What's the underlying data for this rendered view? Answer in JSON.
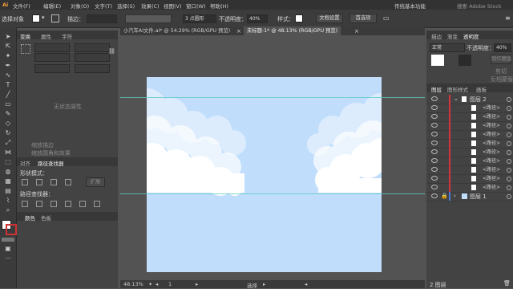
{
  "menu": {
    "logo": "Ai",
    "items": [
      "文件(F)",
      "编辑(E)",
      "对象(O)",
      "文字(T)",
      "选择(S)",
      "效果(C)",
      "视图(V)",
      "窗口(W)",
      "帮助(H)"
    ],
    "workspace": "传统基本功能",
    "search_placeholder": "搜索 Adobe Stock"
  },
  "control": {
    "selection_label": "选择对象",
    "stroke_label": "描边：",
    "brush_value": "3 点圆形",
    "opacity_label": "不透明度：",
    "opacity_value": "40%",
    "style_label": "样式：",
    "doc_setup": "文档设置",
    "preferences": "首选项"
  },
  "doc_tabs": [
    {
      "label": "小汽车AI文件.ai* @ 54.29% (RGB/GPU 预览)",
      "active": false
    },
    {
      "label": "未标题-1* @ 48.13% (RGB/GPU 预览)",
      "active": true
    }
  ],
  "left_panel": {
    "tabs_top": [
      "变换",
      "属性",
      "字符"
    ],
    "no_selection": "无状态属性",
    "checkbox1": "缩放描边",
    "checkbox2": "缩放圆角和效果",
    "tabs_mid": [
      "对齐",
      "路径查找器"
    ],
    "shape_modes": "形状模式：",
    "expand": "扩展",
    "pathfinder": "路径查找器：",
    "tabs_bottom": [
      "颜色",
      "色板"
    ]
  },
  "right_panel": {
    "tabs_top": [
      "描边",
      "渐变",
      "透明度"
    ],
    "blend_mode": "正常",
    "opacity_label": "不透明度：",
    "opacity_value": "40%",
    "make_mask": "制作蒙版",
    "clip": "剪切",
    "invert": "反相蒙版",
    "tabs_layers": [
      "图层",
      "图形样式",
      "画板"
    ],
    "layer2_name": "图层 2",
    "sublayer_label": "<路径>",
    "layer1_name": "图层 1",
    "layers_count": "2 图层"
  },
  "status": {
    "zoom": "48.13%",
    "artboard_num": "1",
    "tool": "选择"
  },
  "colors": {
    "sky": "#c0defc",
    "cloud": "#ffffff",
    "guide": "#5ec8c0",
    "layer_red": "#d9333f"
  }
}
